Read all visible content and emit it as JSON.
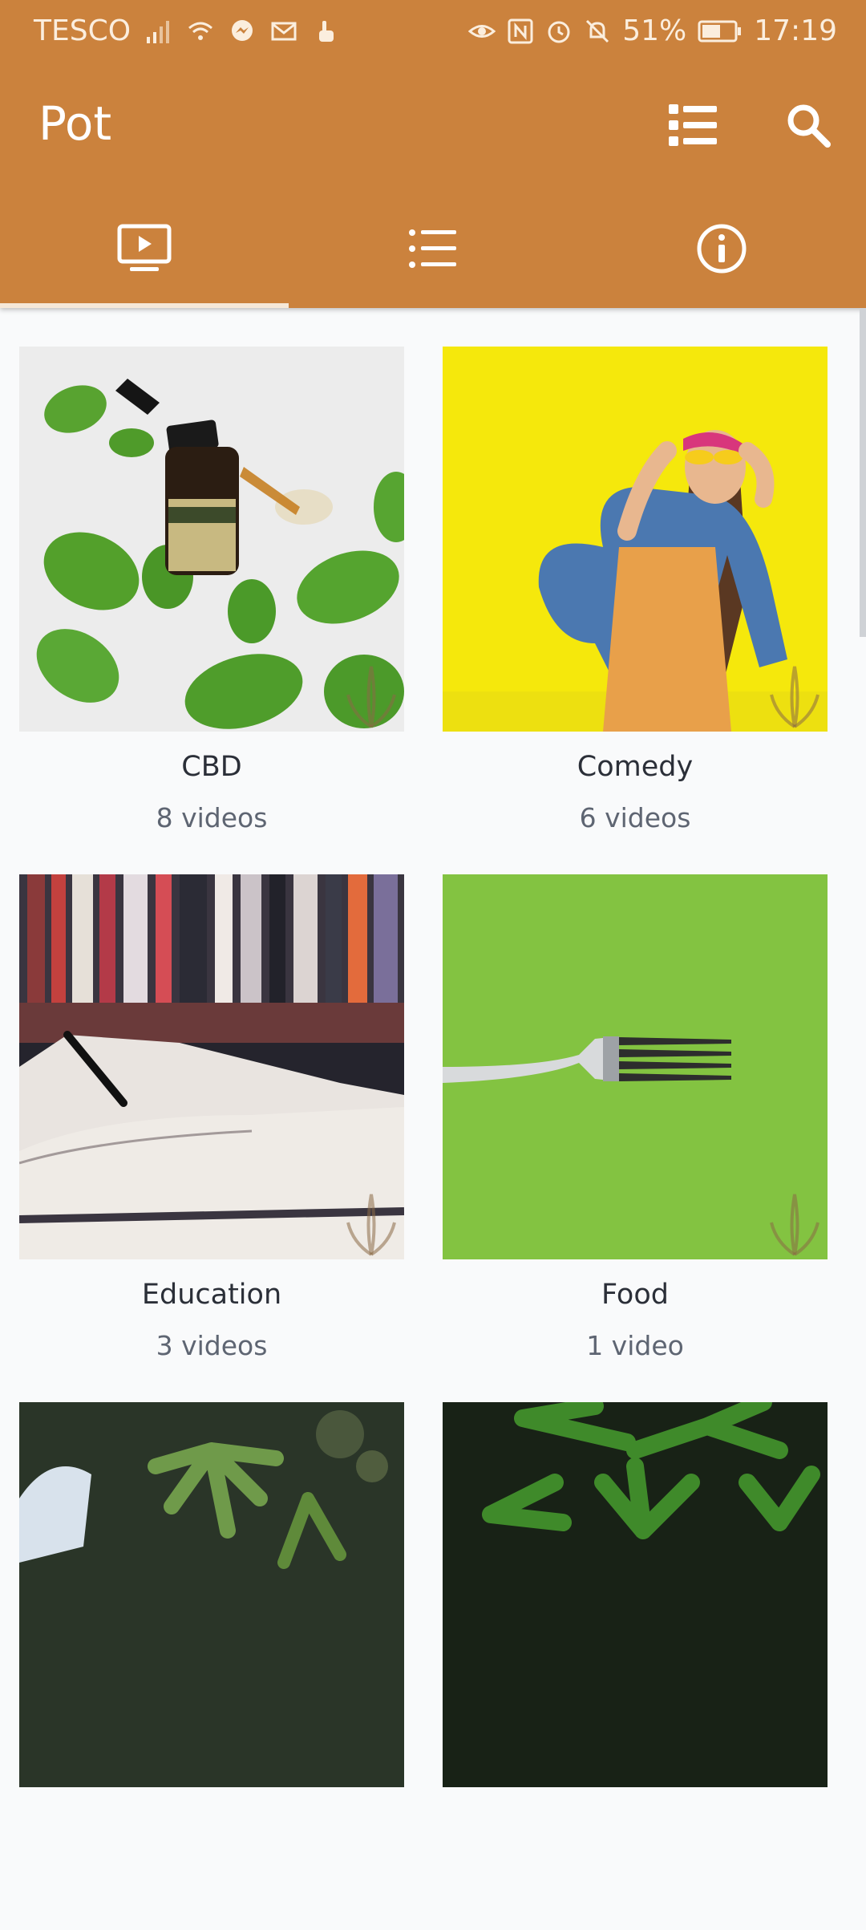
{
  "status_bar": {
    "carrier": "TESCO",
    "battery": "51%",
    "time": "17:19"
  },
  "toolbar": {
    "title": "Pot",
    "list_icon": "list-icon",
    "search_icon": "search-icon"
  },
  "tabs": [
    {
      "icon": "video-icon",
      "selected": true
    },
    {
      "icon": "list-icon",
      "selected": false
    },
    {
      "icon": "info-icon",
      "selected": false
    }
  ],
  "categories": [
    {
      "title": "CBD",
      "count": "8 videos",
      "image": "cbd-oil-with-mint-leaves"
    },
    {
      "title": "Comedy",
      "count": "6 videos",
      "image": "laughing-woman-yellow-wall"
    },
    {
      "title": "Education",
      "count": "3 videos",
      "image": "open-books-bookshelf"
    },
    {
      "title": "Food",
      "count": "1 video",
      "image": "fork-on-green"
    },
    {
      "title": "",
      "count": "",
      "image": "gloved-hand-cannabis"
    },
    {
      "title": "",
      "count": "",
      "image": "cannabis-leaves-dark"
    }
  ],
  "colors": {
    "app_bar": "#cb823d",
    "background": "#f9fafb",
    "title_text": "#2b2f38",
    "count_text": "#5e6572"
  }
}
